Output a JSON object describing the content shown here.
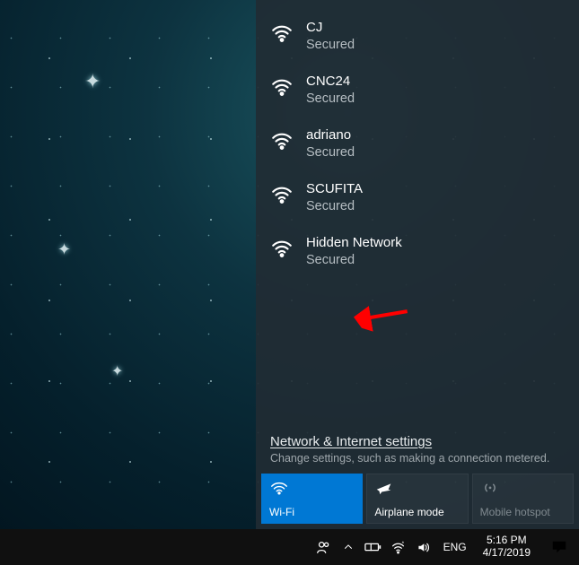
{
  "networks": [
    {
      "name": "CJ",
      "status": "Secured"
    },
    {
      "name": "CNC24",
      "status": "Secured"
    },
    {
      "name": "adriano",
      "status": "Secured"
    },
    {
      "name": "SCUFITA",
      "status": "Secured"
    },
    {
      "name": "Hidden Network",
      "status": "Secured"
    }
  ],
  "settings": {
    "link": "Network & Internet settings",
    "hint": "Change settings, such as making a connection metered."
  },
  "actions": {
    "wifi": "Wi-Fi",
    "airplane": "Airplane mode",
    "hotspot": "Mobile hotspot"
  },
  "tray": {
    "lang": "ENG",
    "time": "5:16 PM",
    "date": "4/17/2019"
  }
}
